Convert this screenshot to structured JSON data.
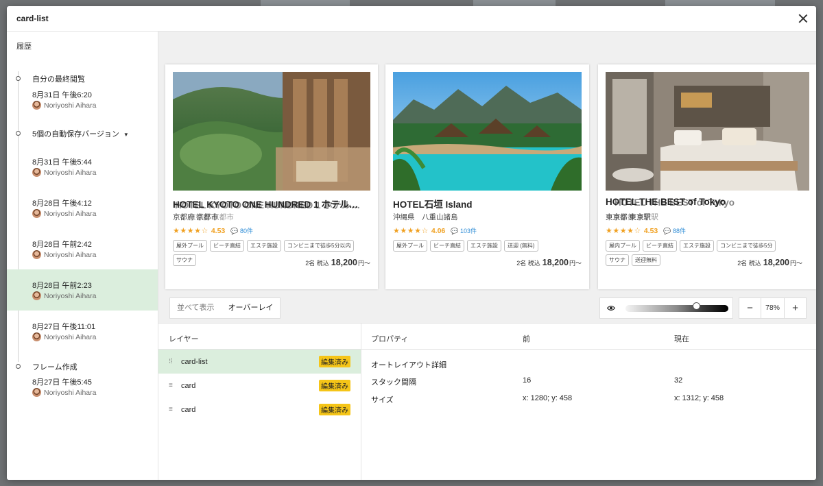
{
  "modal": {
    "title": "card-list"
  },
  "history": {
    "title": "履歴",
    "entries": [
      {
        "label": "自分の最終閲覧",
        "time": "8月31日 午後6:20",
        "user": "Noriyoshi Aihara"
      },
      {
        "label": "5個の自動保存バージョン"
      },
      {
        "time": "8月31日 午後5:44",
        "user": "Noriyoshi Aihara"
      },
      {
        "time": "8月28日 午後4:12",
        "user": "Noriyoshi Aihara"
      },
      {
        "time": "8月28日 午前2:42",
        "user": "Noriyoshi Aihara"
      },
      {
        "time": "8月28日 午前2:23",
        "user": "Noriyoshi Aihara"
      },
      {
        "time": "8月27日 午後11:01",
        "user": "Noriyoshi Aihara"
      },
      {
        "label": "フレーム作成",
        "time": "8月27日 午後5:45",
        "user": "Noriyoshi Aihara"
      }
    ]
  },
  "cards": [
    {
      "name": "HOTEL KYOTO ONE HUNDRED 1 ホテル…",
      "name_overlay": "HOTEL KYOTO ONE HUNDRED 1 ホテル…",
      "location": "京都府 京都市",
      "stars": "★★★★☆",
      "score": "4.53",
      "reviews": "💬 80件",
      "tags": [
        "屋外プール",
        "ビーチ直結",
        "エステ施設",
        "コンビニまで徒歩5分以内",
        "サウナ"
      ],
      "guests": "2名 税込",
      "price": "18,200",
      "price_suffix": "円〜"
    },
    {
      "name": "HOTEL石垣 Island",
      "location": "沖縄県　八重山諸島",
      "stars": "★★★★☆",
      "score": "4.06",
      "reviews": "💬 103件",
      "tags": [
        "屋外プール",
        "ビーチ直結",
        "エステ施設",
        "送迎 (無料)"
      ],
      "guests": "2名 税込",
      "price": "18,200",
      "price_suffix": "円〜"
    },
    {
      "name": "HOTEL THE BEST of Tokyo",
      "name_overlay": "HOTEL THE BEST of Tokyo",
      "location": "東京都 東京駅",
      "stars": "★★★★☆",
      "score": "4.53",
      "reviews": "💬 88件",
      "tags": [
        "屋内プール",
        "ビーチ直結",
        "エステ施設",
        "コンビニまで徒歩5分",
        "サウナ",
        "送迎無料"
      ],
      "guests": "2名 税込",
      "price": "18,200",
      "price_suffix": "円〜"
    }
  ],
  "view": {
    "side_by_side": "並べて表示",
    "overlay": "オーバーレイ",
    "opacity_fraction": 0.5,
    "zoom": "78%",
    "zoom_out": "−",
    "zoom_in": "+"
  },
  "layers": {
    "title": "レイヤー",
    "items": [
      {
        "icon": "frame-icon",
        "name": "card-list",
        "badge": "編集済み"
      },
      {
        "icon": "text-lines-icon",
        "name": "card",
        "badge": "編集済み"
      },
      {
        "icon": "text-lines-icon",
        "name": "card",
        "badge": "編集済み"
      }
    ]
  },
  "properties": {
    "headers": {
      "property": "プロパティ",
      "before": "前",
      "current": "現在"
    },
    "section": "オートレイアウト詳細",
    "rows": [
      {
        "name": "スタック間隔",
        "before": "16",
        "current": "32"
      },
      {
        "name": "サイズ",
        "before": "x: 1280; y: 458",
        "current": "x: 1312; y: 458"
      }
    ]
  }
}
